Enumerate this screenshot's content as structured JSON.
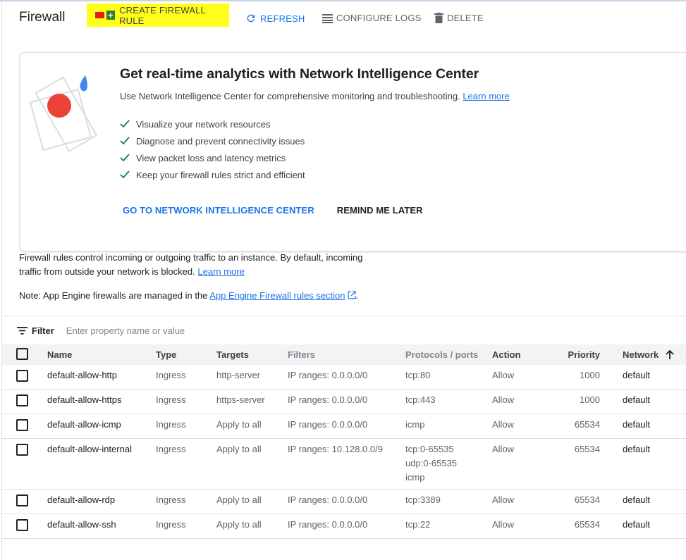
{
  "header": {
    "title": "Firewall",
    "create_label": "CREATE FIREWALL RULE",
    "refresh_label": "REFRESH",
    "configure_logs_label": "CONFIGURE LOGS",
    "delete_label": "DELETE"
  },
  "promo": {
    "title": "Get real-time analytics with Network Intelligence Center",
    "description": "Use Network Intelligence Center for comprehensive monitoring and troubleshooting.",
    "learn_more": "Learn more",
    "checks": [
      "Visualize your network resources",
      "Diagnose and prevent connectivity issues",
      "View packet loss and latency metrics",
      "Keep your firewall rules strict and efficient"
    ],
    "go_label": "GO TO NETWORK INTELLIGENCE CENTER",
    "remind_label": "REMIND ME LATER"
  },
  "info": {
    "text": "Firewall rules control incoming or outgoing traffic to an instance. By default, incoming traffic from outside your network is blocked.",
    "learn_more": "Learn more",
    "note_prefix": "Note: App Engine firewalls are managed in the",
    "note_link": "App Engine Firewall rules section",
    "note_suffix": "."
  },
  "filter": {
    "label": "Filter",
    "placeholder": "Enter property name or value"
  },
  "table": {
    "columns": {
      "name": "Name",
      "type": "Type",
      "targets": "Targets",
      "filters": "Filters",
      "protocols": "Protocols / ports",
      "action": "Action",
      "priority": "Priority",
      "network": "Network"
    },
    "sort_icon": "arrow-up-icon",
    "rows": [
      {
        "name": "default-allow-http",
        "type": "Ingress",
        "targets": "http-server",
        "filters": "IP ranges: 0.0.0.0/0",
        "protocols": [
          "tcp:80"
        ],
        "action": "Allow",
        "priority": "1000",
        "network": "default"
      },
      {
        "name": "default-allow-https",
        "type": "Ingress",
        "targets": "https-server",
        "filters": "IP ranges: 0.0.0.0/0",
        "protocols": [
          "tcp:443"
        ],
        "action": "Allow",
        "priority": "1000",
        "network": "default"
      },
      {
        "name": "default-allow-icmp",
        "type": "Ingress",
        "targets": "Apply to all",
        "filters": "IP ranges: 0.0.0.0/0",
        "protocols": [
          "icmp"
        ],
        "action": "Allow",
        "priority": "65534",
        "network": "default"
      },
      {
        "name": "default-allow-internal",
        "type": "Ingress",
        "targets": "Apply to all",
        "filters": "IP ranges: 10.128.0.0/9",
        "protocols": [
          "tcp:0-65535",
          "udp:0-65535",
          "icmp"
        ],
        "action": "Allow",
        "priority": "65534",
        "network": "default"
      },
      {
        "name": "default-allow-rdp",
        "type": "Ingress",
        "targets": "Apply to all",
        "filters": "IP ranges: 0.0.0.0/0",
        "protocols": [
          "tcp:3389"
        ],
        "action": "Allow",
        "priority": "65534",
        "network": "default"
      },
      {
        "name": "default-allow-ssh",
        "type": "Ingress",
        "targets": "Apply to all",
        "filters": "IP ranges: 0.0.0.0/0",
        "protocols": [
          "tcp:22"
        ],
        "action": "Allow",
        "priority": "65534",
        "network": "default"
      }
    ]
  },
  "colors": {
    "accent": "#1a73e8",
    "highlight": "#ffff1a",
    "check": "#188038"
  }
}
